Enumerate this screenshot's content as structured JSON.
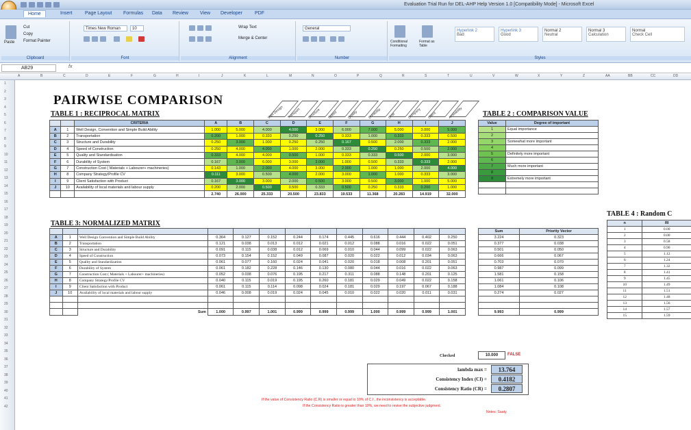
{
  "window": {
    "title": "Evaluation Trial Run for DEL-AHP Help Version 1.0 [Compatibility Mode] - Microsoft Excel"
  },
  "ribbon": {
    "tabs": [
      "Home",
      "Insert",
      "Page Layout",
      "Formulas",
      "Data",
      "Review",
      "View",
      "Developer",
      "PDF"
    ],
    "font_name": "Times New Roman",
    "font_size": "10",
    "number_format": "General",
    "styles": [
      "Hyperlink 2",
      "Hyperlink 3",
      "Normal 2",
      "Normal 3",
      "Normal"
    ],
    "styles_sub": [
      "Bad",
      "Good",
      "Neutral",
      "Calculation",
      "Check Cell"
    ],
    "groups": [
      "Clipboard",
      "Font",
      "Alignment",
      "Number",
      "Styles"
    ],
    "clipboard": [
      "Cut",
      "Copy",
      "Format Painter"
    ],
    "paste": "Paste",
    "alignment": [
      "Wrap Text",
      "Merge & Center"
    ],
    "cond": "Conditional Formatting",
    "fmt_table": "Format as Table"
  },
  "formula_bar": {
    "cell": "AB29",
    "fx": "fx",
    "value": ""
  },
  "sheet": {
    "title": "PAIRWISE COMPARISON",
    "table1": {
      "title": "TABLE 1 : RECIPROCAL MATRIX",
      "criteria_header": "CRITERIA",
      "cols": [
        "A",
        "B",
        "C",
        "D",
        "E",
        "F",
        "G",
        "H",
        "I",
        "J"
      ],
      "diag_labels": [
        "Well Design",
        "Transport",
        "Structure",
        "Speed",
        "Quality",
        "Durability",
        "Cost",
        "Company",
        "Client",
        "Availability"
      ],
      "rows": [
        {
          "id": "A",
          "n": "1",
          "name": "Well Design, Convention and Simple Build Ability",
          "v": [
            "1.000",
            "5.000",
            "4.000",
            "4.000",
            "3.000",
            "6.000",
            "7.000",
            "5.000",
            "3.000",
            "5.000"
          ]
        },
        {
          "id": "B",
          "n": "2",
          "name": "Transportation",
          "v": [
            "0.200",
            "1.000",
            "0.333",
            "0.250",
            "0.250",
            "0.333",
            "1.000",
            "0.333",
            "0.333",
            "0.500"
          ]
        },
        {
          "id": "C",
          "n": "3",
          "name": "Structure and Durability",
          "v": [
            "0.250",
            "3.000",
            "1.000",
            "0.250",
            "0.250",
            "0.167",
            "0.500",
            "2.000",
            "0.333",
            "2.000"
          ]
        },
        {
          "id": "D",
          "n": "4",
          "name": "Speed of Construction",
          "v": [
            "0.250",
            "4.000",
            "4.000",
            "1.000",
            "2.000",
            "0.333",
            "0.250",
            "0.250",
            "0.500",
            "2.000"
          ]
        },
        {
          "id": "E",
          "n": "5",
          "name": "Quality and Standardisation",
          "v": [
            "0.333",
            "4.000",
            "4.000",
            "0.500",
            "1.000",
            "0.333",
            "0.333",
            "0.500",
            "2.000",
            "3.000"
          ]
        },
        {
          "id": "F",
          "n": "6",
          "name": "Durability of System",
          "v": [
            "0.167",
            "3.000",
            "6.000",
            "3.000",
            "3.000",
            "1.000",
            "0.500",
            "0.333",
            "0.333",
            "2.000"
          ]
        },
        {
          "id": "G",
          "n": "7",
          "name": "Construction Cost ( Materials + Labourer+ machineries)",
          "v": [
            "0.143",
            "1.000",
            "2.000",
            "4.000",
            "3.000",
            "2.000",
            "1.000",
            "1.000",
            "2.000",
            "4.000"
          ]
        },
        {
          "id": "H",
          "n": "8",
          "name": "Company Strategy/Profile CV",
          "v": [
            "0.111",
            "3.000",
            "0.500",
            "4.000",
            "2.000",
            "3.000",
            "1.000",
            "1.000",
            "0.333",
            "3.000"
          ]
        },
        {
          "id": "I",
          "n": "9",
          "name": "Client Satisfaction with Product",
          "v": [
            "0.167",
            "3.000",
            "3.000",
            "2.000",
            "0.500",
            "3.000",
            "0.500",
            "3.000",
            "1.000",
            "5.000"
          ]
        },
        {
          "id": "J",
          "n": "10",
          "name": "Availability of local materials and labour supply",
          "v": [
            "0.200",
            "2.000",
            "0.500",
            "0.500",
            "0.333",
            "0.500",
            "0.250",
            "0.333",
            "0.200",
            "1.000"
          ]
        }
      ],
      "sums": [
        "2.740",
        "26.000",
        "25.333",
        "20.500",
        "23.833",
        "19.533",
        "11.368",
        "20.283",
        "14.919",
        "32.000"
      ]
    },
    "table2": {
      "title": "TABLE 2 : COMPARISON VALUE",
      "headers": [
        "Value",
        "Degree of important"
      ],
      "rows": [
        {
          "v": "1",
          "d": "Equal importance"
        },
        {
          "v": "2",
          "d": ""
        },
        {
          "v": "3",
          "d": "Somewhat more important"
        },
        {
          "v": "4",
          "d": ""
        },
        {
          "v": "5",
          "d": "Definitely more important"
        },
        {
          "v": "6",
          "d": ""
        },
        {
          "v": "7",
          "d": "Much more important"
        },
        {
          "v": "8",
          "d": ""
        },
        {
          "v": "9",
          "d": "Extremely more important"
        }
      ]
    },
    "table3": {
      "title": "TABLE 3: NORMALIZED MATRIX",
      "rows": [
        {
          "id": "A",
          "n": "1",
          "name": "Well Design Convention and Simple Build Ability",
          "v": [
            "0.364",
            "0.127",
            "0.152",
            "0.244",
            "0.174",
            "0.445",
            "0.616",
            "0.444",
            "0.402",
            "0.250"
          ]
        },
        {
          "id": "B",
          "n": "2",
          "name": "Transportation",
          "v": [
            "0.121",
            "0.038",
            "0.013",
            "0.012",
            "0.021",
            "0.012",
            "0.088",
            "0.016",
            "0.022",
            "0.051"
          ]
        },
        {
          "id": "C",
          "n": "3",
          "name": "Structure and Durability",
          "v": [
            "0.091",
            "0.115",
            "0.038",
            "0.012",
            "0.069",
            "0.010",
            "0.044",
            "0.099",
            "0.022",
            "0.063"
          ]
        },
        {
          "id": "D",
          "n": "4",
          "name": "Speed of Construction",
          "v": [
            "0.073",
            "0.154",
            "0.152",
            "0.049",
            "0.087",
            "0.020",
            "0.022",
            "0.012",
            "0.034",
            "0.063"
          ]
        },
        {
          "id": "E",
          "n": "5",
          "name": "Quality and Standardization",
          "v": [
            "0.061",
            "0.077",
            "0.160",
            "0.024",
            "0.041",
            "0.020",
            "0.018",
            "0.008",
            "0.201",
            "0.051"
          ]
        },
        {
          "id": "F",
          "n": "6",
          "name": "Durability of System",
          "v": [
            "0.061",
            "0.182",
            "0.228",
            "0.146",
            "0.130",
            "0.080",
            "0.044",
            "0.016",
            "0.022",
            "0.063"
          ]
        },
        {
          "id": "G",
          "n": "7",
          "name": "Construction Cost ( Materials + Labourer+ machineries)",
          "v": [
            "0.052",
            "0.038",
            "0.076",
            "0.195",
            "0.217",
            "0.311",
            "0.088",
            "0.148",
            "0.201",
            "0.125"
          ]
        },
        {
          "id": "H",
          "n": "8",
          "name": "Company Strategy/Profile CV",
          "v": [
            "0.040",
            "0.115",
            "0.019",
            "0.195",
            "0.260",
            "0.181",
            "0.029",
            "0.049",
            "0.022",
            "0.158"
          ]
        },
        {
          "id": "I",
          "n": "9",
          "name": "Client Satisfaction with Product",
          "v": [
            "0.061",
            "0.115",
            "0.114",
            "0.098",
            "0.024",
            "0.181",
            "0.029",
            "0.197",
            "0.067",
            "0.188"
          ]
        },
        {
          "id": "J",
          "n": "10",
          "name": "Availability of local materials and labour supply",
          "v": [
            "0.046",
            "0.008",
            "0.019",
            "0.024",
            "0.045",
            "0.010",
            "0.022",
            "0.020",
            "0.011",
            "0.031"
          ]
        }
      ],
      "sum_label": "Sum",
      "sums": [
        "1.000",
        "0.997",
        "1.001",
        "0.999",
        "0.999",
        "0.999",
        "1.000",
        "0.999",
        "0.999",
        "1.001"
      ]
    },
    "table_sum": {
      "headers": [
        "Sum",
        "Priority Vector"
      ],
      "rows": [
        [
          "3.224",
          "0.323"
        ],
        [
          "0.377",
          "0.038"
        ],
        [
          "0.501",
          "0.050"
        ],
        [
          "0.666",
          "0.067"
        ],
        [
          "0.703",
          "0.070"
        ],
        [
          "0.987",
          "0.099"
        ],
        [
          "1.581",
          "0.158"
        ],
        [
          "1.061",
          "0.106"
        ],
        [
          "1.084",
          "0.108"
        ],
        [
          "0.274",
          "0.027"
        ]
      ],
      "total": [
        "9.993",
        "0.999"
      ]
    },
    "table4": {
      "title": "TABLE 4 : Random C",
      "headers": [
        "n",
        "RI"
      ],
      "rows": [
        [
          "1",
          "0.00"
        ],
        [
          "2",
          "0.00"
        ],
        [
          "3",
          "0.58"
        ],
        [
          "4",
          "0.90"
        ],
        [
          "5",
          "1.12"
        ],
        [
          "6",
          "1.24"
        ],
        [
          "7",
          "1.32"
        ],
        [
          "8",
          "1.41"
        ],
        [
          "9",
          "1.45"
        ],
        [
          "10",
          "1.49"
        ],
        [
          "11",
          "1.51"
        ],
        [
          "12",
          "1.48"
        ],
        [
          "13",
          "1.56"
        ],
        [
          "14",
          "1.57"
        ],
        [
          "15",
          "1.59"
        ]
      ]
    },
    "checked": {
      "label": "Checked",
      "value": "10.000",
      "flag": "FALSE"
    },
    "consistency": [
      {
        "label": "lambda max  =",
        "value": "13.764"
      },
      {
        "label": "Consistency Index (CI) =",
        "value": "0.4182"
      },
      {
        "label": "Consistency Ratio (CR) =",
        "value": "0.2807"
      }
    ],
    "notes": [
      "If the value of Consistency Ratio (C.R) is smaller or equal to 10% of C.I , the inconsistency is acceptable.",
      "If the Consistency Ratio is greater than 10%, we need to revise the subjective judgment.",
      "Notes: Saaty"
    ]
  }
}
